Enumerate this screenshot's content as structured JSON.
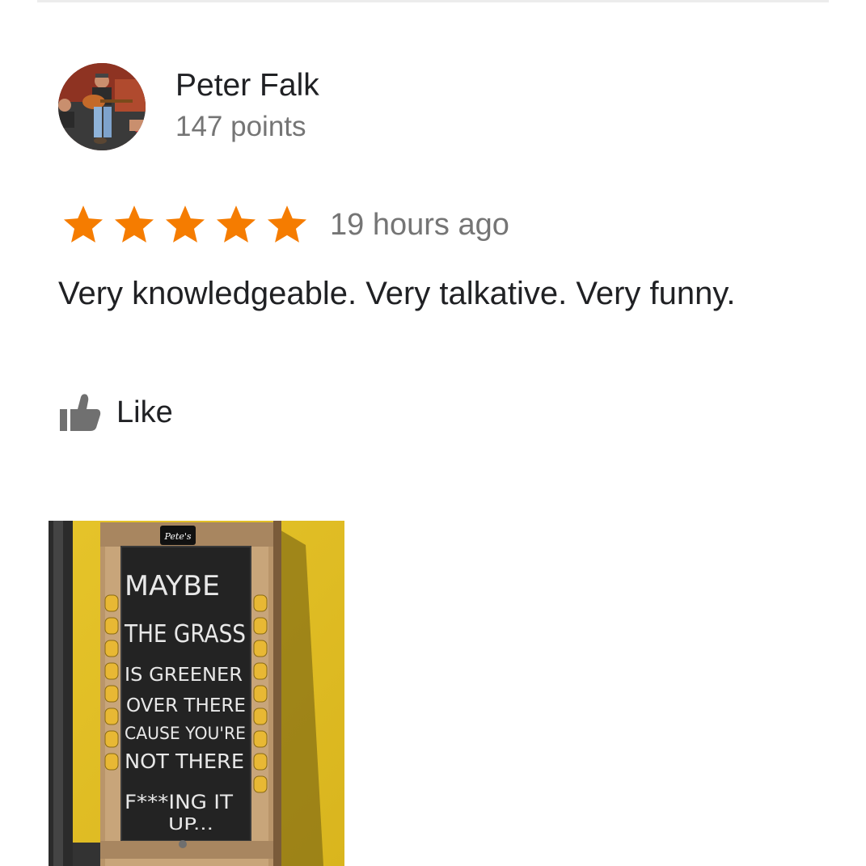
{
  "review": {
    "author": {
      "name": "Peter Falk",
      "points": "147 points"
    },
    "rating": 1.0,
    "stars_shown": 5,
    "time": "19 hours ago",
    "text": "Very knowledgeable. Very talkative. Very funny.",
    "like_label": "Like",
    "photo_sign": {
      "brand": "Pete's",
      "lines": [
        "MAYBE",
        "THE GRASS",
        "IS GREENER",
        "OVER THERE",
        "CAUSE YOU'RE",
        "NOT THERE",
        "F***ING IT",
        "UP..."
      ]
    }
  },
  "colors": {
    "star": "#F57C00",
    "secondary_text": "#757575",
    "primary_text": "#202124",
    "like_icon": "#707070"
  },
  "icons": {
    "like": "thumbs-up-icon",
    "star": "star-icon"
  }
}
